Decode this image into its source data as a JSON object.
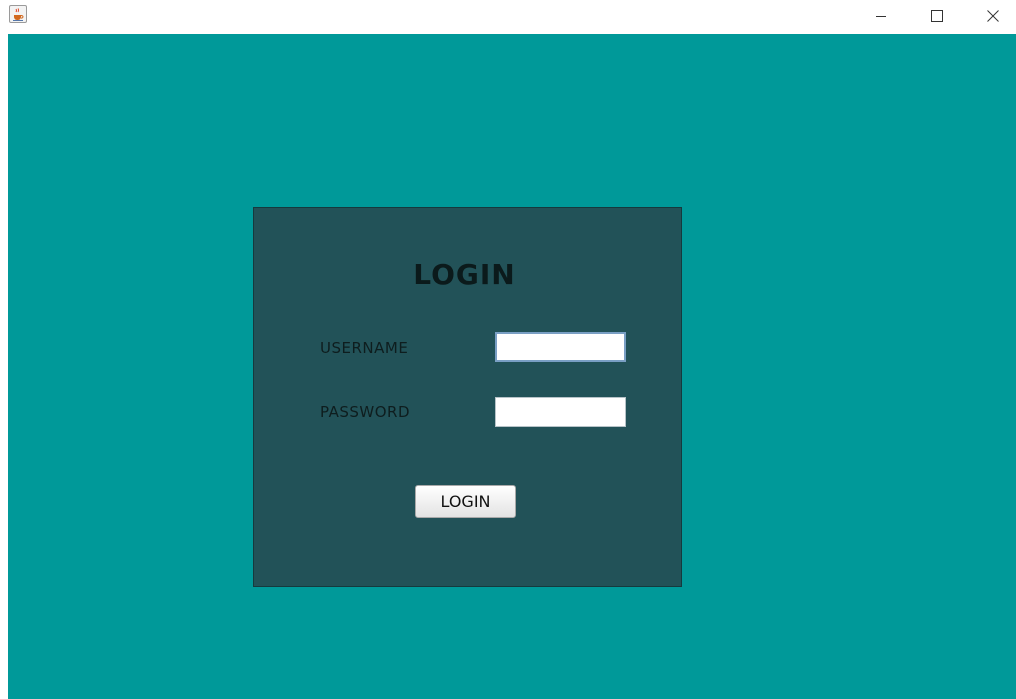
{
  "window": {
    "app_icon": "java-coffee-cup-icon",
    "controls": {
      "minimize_icon": "minimize-icon",
      "maximize_icon": "maximize-icon",
      "close_icon": "close-icon"
    }
  },
  "colors": {
    "background": "#009999",
    "panel": "#225258",
    "text": "#0e1d1e"
  },
  "login": {
    "title": "LOGIN",
    "username_label": "USERNAME",
    "username_value": "",
    "password_label": "PASSWORD",
    "password_value": "",
    "button_label": "LOGIN"
  }
}
